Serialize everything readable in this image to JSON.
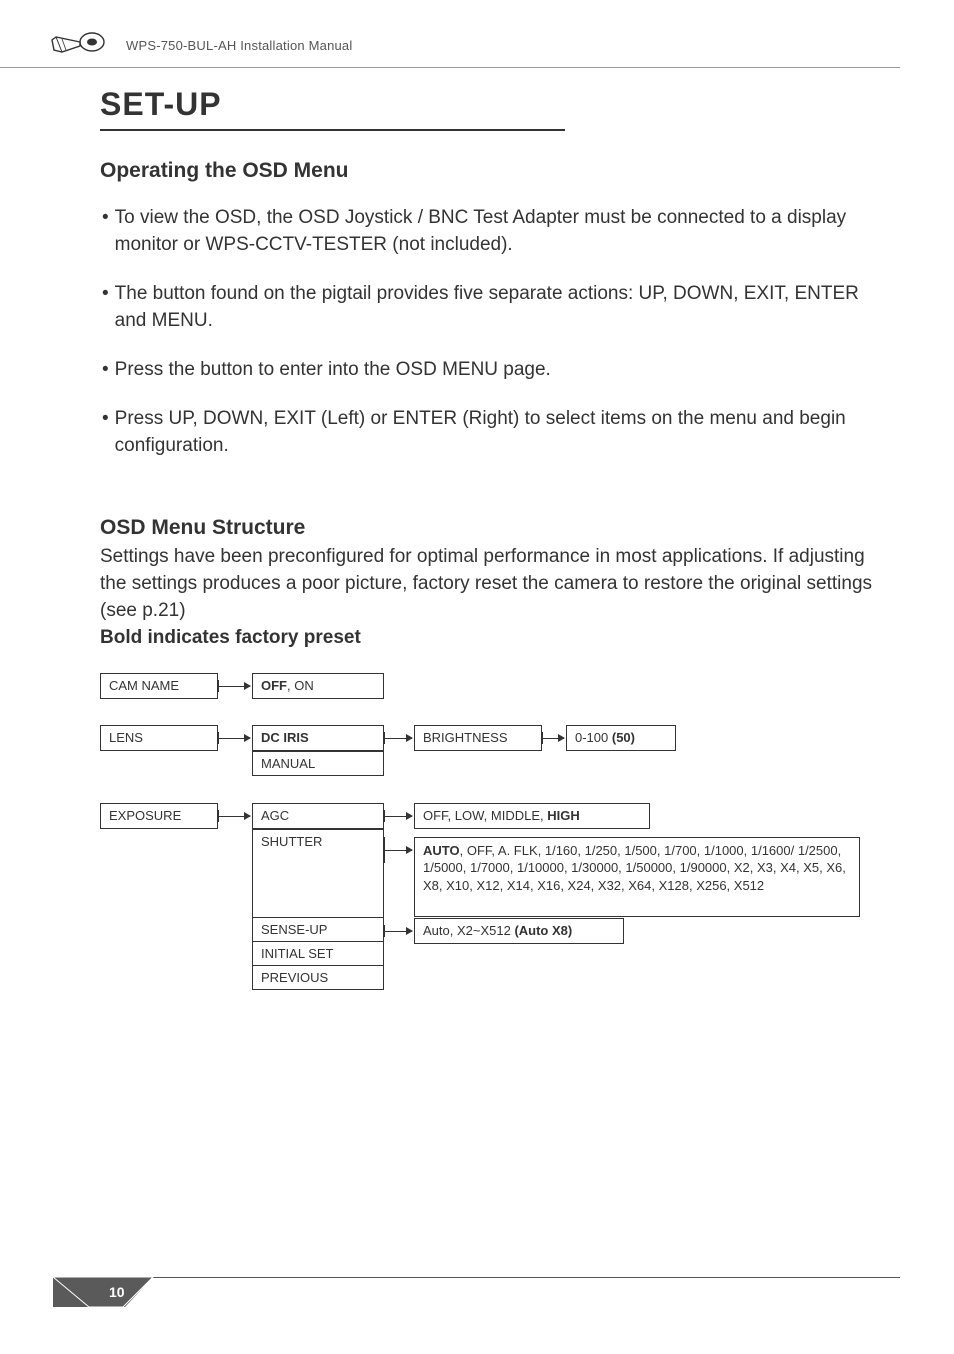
{
  "doc_title": "WPS-750-BUL-AH Installation Manual",
  "h1": "SET-UP",
  "section1": {
    "heading": "Operating the OSD Menu",
    "bullets": [
      "To view the OSD, the OSD Joystick / BNC Test Adapter must be connected to a display monitor or WPS-CCTV-TESTER (not included).",
      "The button found on the pigtail provides five separate actions: UP, DOWN, EXIT, ENTER and MENU.",
      "Press the button to enter into the OSD MENU page.",
      "Press UP, DOWN, EXIT (Left) or ENTER (Right) to select items on the menu and begin configuration."
    ]
  },
  "section2": {
    "heading": "OSD Menu Structure",
    "para": "Settings have been preconfigured for optimal performance in most applications.  If adjusting the settings produces a poor picture, factory reset the camera to restore the original settings (see p.21)",
    "bold_note": "Bold indicates factory preset"
  },
  "chart_data": {
    "type": "diagram",
    "title": "OSD Menu Structure",
    "tree": [
      {
        "label": "CAM NAME",
        "options": {
          "bold": "OFF",
          "rest": ", ON"
        }
      },
      {
        "label": "LENS",
        "children": [
          {
            "label_bold": "DC IRIS",
            "children": [
              {
                "label": "BRIGHTNESS",
                "options": {
                  "prefix": "0-100 ",
                  "bold": "(50)"
                }
              }
            ]
          },
          {
            "label": "MANUAL"
          }
        ]
      },
      {
        "label": "EXPOSURE",
        "children": [
          {
            "label": "AGC",
            "options": {
              "prefix": "OFF, LOW, MIDDLE, ",
              "bold": "HIGH"
            }
          },
          {
            "label": "SHUTTER",
            "options": {
              "bold": "AUTO",
              "rest": ", OFF, A. FLK, 1/160, 1/250, 1/500, 1/700, 1/1000, 1/1600/ 1/2500, 1/5000, 1/7000, 1/10000, 1/30000, 1/50000, 1/90000, X2, X3, X4, X5, X6, X8, X10, X12, X14, X16, X24, X32, X64, X128, X256, X512"
            }
          },
          {
            "label": "SENSE-UP",
            "options": {
              "prefix": "Auto, X2~X512 ",
              "bold": "(Auto X8)"
            }
          },
          {
            "label": "INITIAL SET"
          },
          {
            "label": "PREVIOUS"
          }
        ]
      }
    ]
  },
  "page_number": "10"
}
